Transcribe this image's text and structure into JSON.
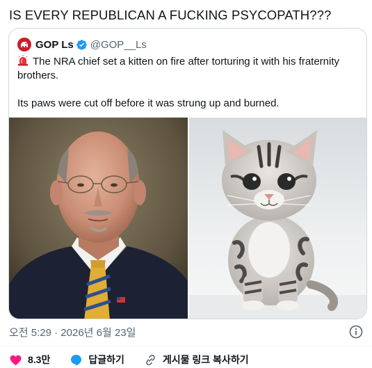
{
  "tweet": {
    "text": "IS EVERY REPUBLICAN A FUCKING PSYCOPATH???",
    "timestamp": "오전 5:29 · 2026년 6월 23일"
  },
  "quote": {
    "display_name": "GOP Ls",
    "handle": "@GOP__Ls",
    "line1": "The NRA chief set a kitten on fire after torturing it with his fraternity",
    "line2": "brothers.",
    "line3": "Its paws were cut off before it was strung up and burned."
  },
  "actions": {
    "likes": "8.3만",
    "reply": "답글하기",
    "copy_link": "게시물 링크 복사하기"
  },
  "colors": {
    "like": "#f91880",
    "reply": "#1d9bf0",
    "verified": "#1d9bf0",
    "avatar": "#c9202c"
  },
  "icons": [
    "gop-logo-icon",
    "verified-badge-icon",
    "siren-icon",
    "info-icon",
    "heart-icon",
    "reply-icon",
    "link-icon"
  ]
}
